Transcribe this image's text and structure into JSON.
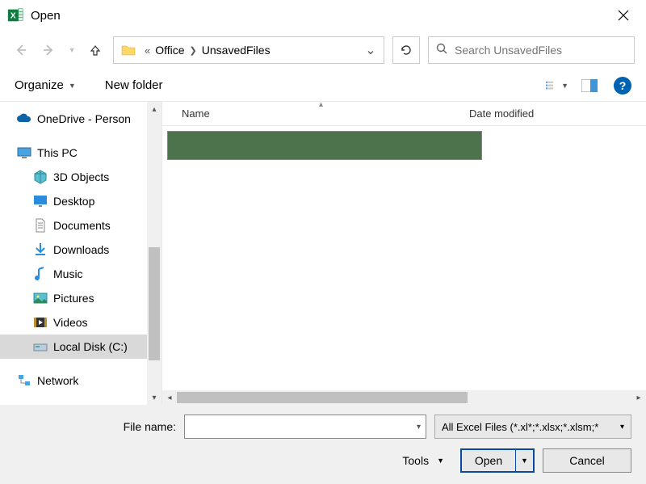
{
  "title": "Open",
  "breadcrumb": {
    "prefix": "«",
    "seg1": "Office",
    "seg2": "UnsavedFiles"
  },
  "search_placeholder": "Search UnsavedFiles",
  "toolbar": {
    "organize": "Organize",
    "newfolder": "New folder",
    "help": "?"
  },
  "columns": {
    "name": "Name",
    "date": "Date modified"
  },
  "tree": {
    "onedrive": "OneDrive - Person",
    "thispc": "This PC",
    "objects3d": "3D Objects",
    "desktop": "Desktop",
    "documents": "Documents",
    "downloads": "Downloads",
    "music": "Music",
    "pictures": "Pictures",
    "videos": "Videos",
    "localdisk": "Local Disk (C:)",
    "network": "Network"
  },
  "footer": {
    "filename_label": "File name:",
    "filetype": "All Excel Files (*.xl*;*.xlsx;*.xlsm;*",
    "tools": "Tools",
    "open": "Open",
    "cancel": "Cancel"
  }
}
